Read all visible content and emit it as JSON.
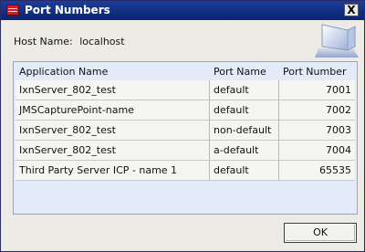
{
  "window": {
    "title": "Port Numbers",
    "close_label": "X"
  },
  "host": {
    "label": "Host Name:",
    "value": "localhost"
  },
  "table": {
    "headers": [
      "Application Name",
      "Port Name",
      "Port Number"
    ],
    "rows": [
      [
        "IxnServer_802_test",
        "default",
        "7001"
      ],
      [
        "JMSCapturePoint-name",
        "default",
        "7002"
      ],
      [
        "IxnServer_802_test",
        "non-default",
        "7003"
      ],
      [
        "IxnServer_802_test",
        "a-default",
        "7004"
      ],
      [
        "Third Party Server ICP - name 1",
        "default",
        "65535"
      ]
    ]
  },
  "buttons": {
    "ok_label": "OK"
  },
  "icons": {
    "app": "app-icon",
    "close": "close-icon",
    "dialog_graphic": "window-graphic-icon"
  },
  "colors": {
    "titlebar": "#0a2470",
    "table_bg": "#e2ebf7",
    "dialog_bg": "#ecebe6"
  }
}
